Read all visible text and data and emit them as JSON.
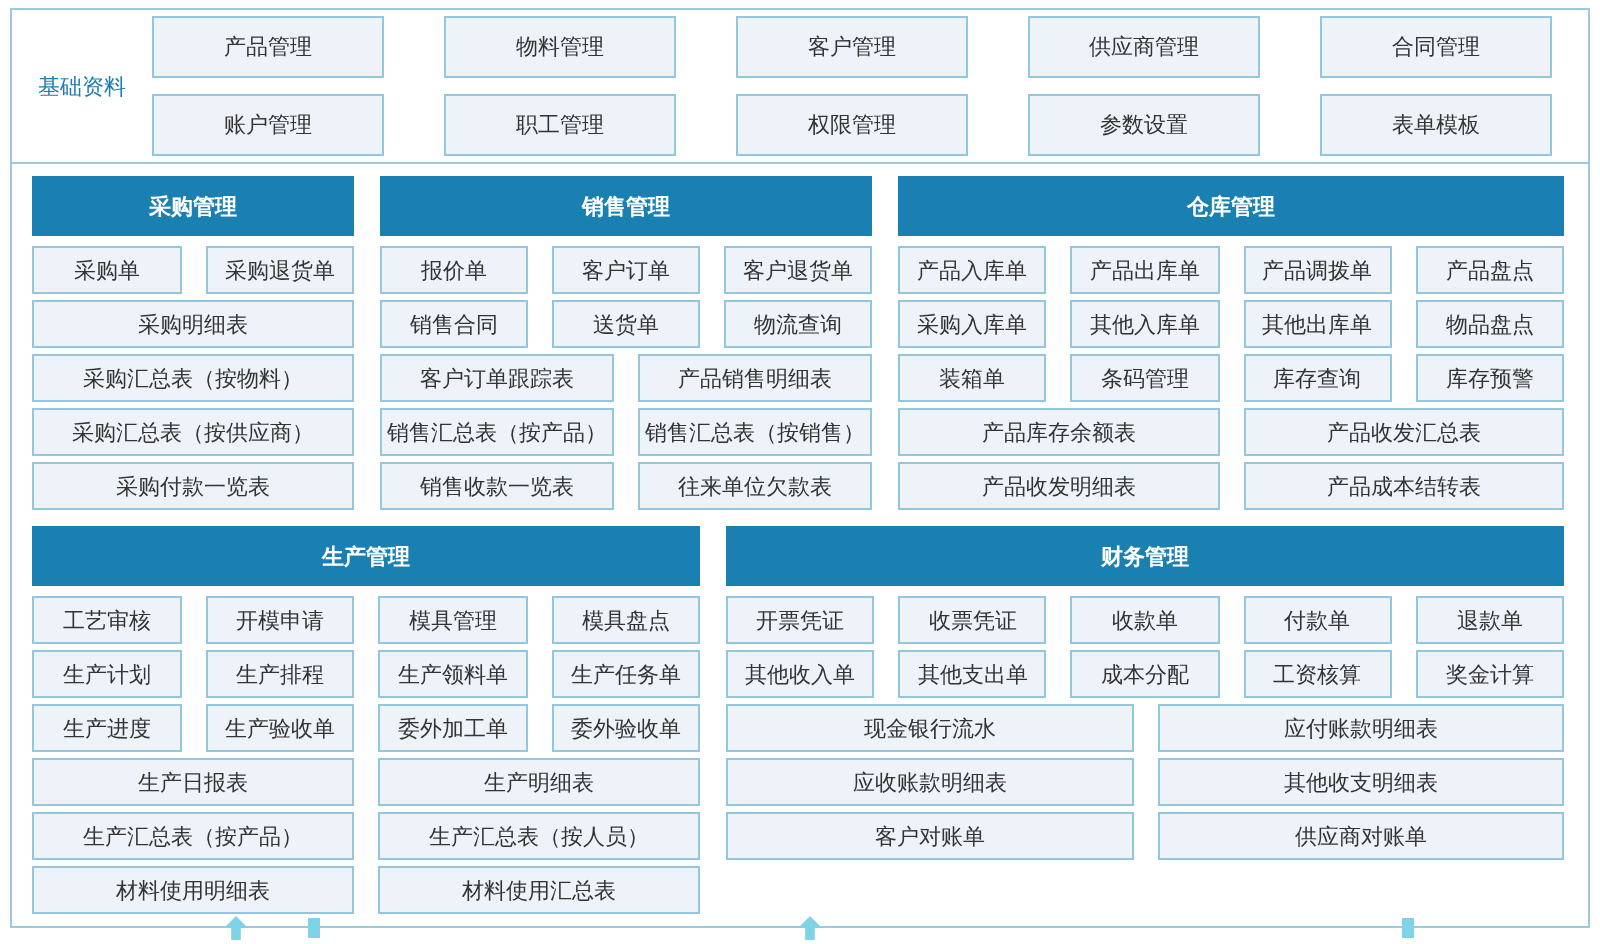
{
  "basic": {
    "title": "基础资料",
    "items": [
      "产品管理",
      "物料管理",
      "客户管理",
      "供应商管理",
      "合同管理",
      "账户管理",
      "职工管理",
      "权限管理",
      "参数设置",
      "表单模板"
    ]
  },
  "panel_rows": [
    [
      {
        "title": "采购管理",
        "rows": [
          [
            "采购单",
            "采购退货单"
          ],
          [
            "采购明细表"
          ],
          [
            "采购汇总表（按物料）"
          ],
          [
            "采购汇总表（按供应商）"
          ],
          [
            "采购付款一览表"
          ]
        ]
      },
      {
        "title": "销售管理",
        "rows": [
          [
            "报价单",
            "客户订单",
            "客户退货单"
          ],
          [
            "销售合同",
            "送货单",
            "物流查询"
          ],
          [
            "客户订单跟踪表",
            "产品销售明细表"
          ],
          [
            "销售汇总表（按产品）",
            "销售汇总表（按销售）"
          ],
          [
            "销售收款一览表",
            "往来单位欠款表"
          ]
        ]
      },
      {
        "title": "仓库管理",
        "rows": [
          [
            "产品入库单",
            "产品出库单",
            "产品调拨单",
            "产品盘点"
          ],
          [
            "采购入库单",
            "其他入库单",
            "其他出库单",
            "物品盘点"
          ],
          [
            "装箱单",
            "条码管理",
            "库存查询",
            "库存预警"
          ],
          [
            "产品库存余额表",
            "产品收发汇总表"
          ],
          [
            "产品收发明细表",
            "产品成本结转表"
          ]
        ]
      }
    ],
    [
      {
        "title": "生产管理",
        "rows": [
          [
            "工艺审核",
            "开模申请",
            "模具管理",
            "模具盘点"
          ],
          [
            "生产计划",
            "生产排程",
            "生产领料单",
            "生产任务单"
          ],
          [
            "生产进度",
            "生产验收单",
            "委外加工单",
            "委外验收单"
          ],
          [
            "生产日报表",
            "生产明细表"
          ],
          [
            "生产汇总表（按产品）",
            "生产汇总表（按人员）"
          ],
          [
            "材料使用明细表",
            "材料使用汇总表"
          ]
        ]
      },
      {
        "title": "财务管理",
        "rows": [
          [
            "开票凭证",
            "收票凭证",
            "收款单",
            "付款单",
            "退款单"
          ],
          [
            "其他收入单",
            "其他支出单",
            "成本分配",
            "工资核算",
            "奖金计算"
          ],
          [
            "现金银行流水",
            "应付账款明细表"
          ],
          [
            "应收账款明细表",
            "其他收支明细表"
          ],
          [
            "客户对账单",
            "供应商对账单"
          ]
        ]
      }
    ]
  ]
}
